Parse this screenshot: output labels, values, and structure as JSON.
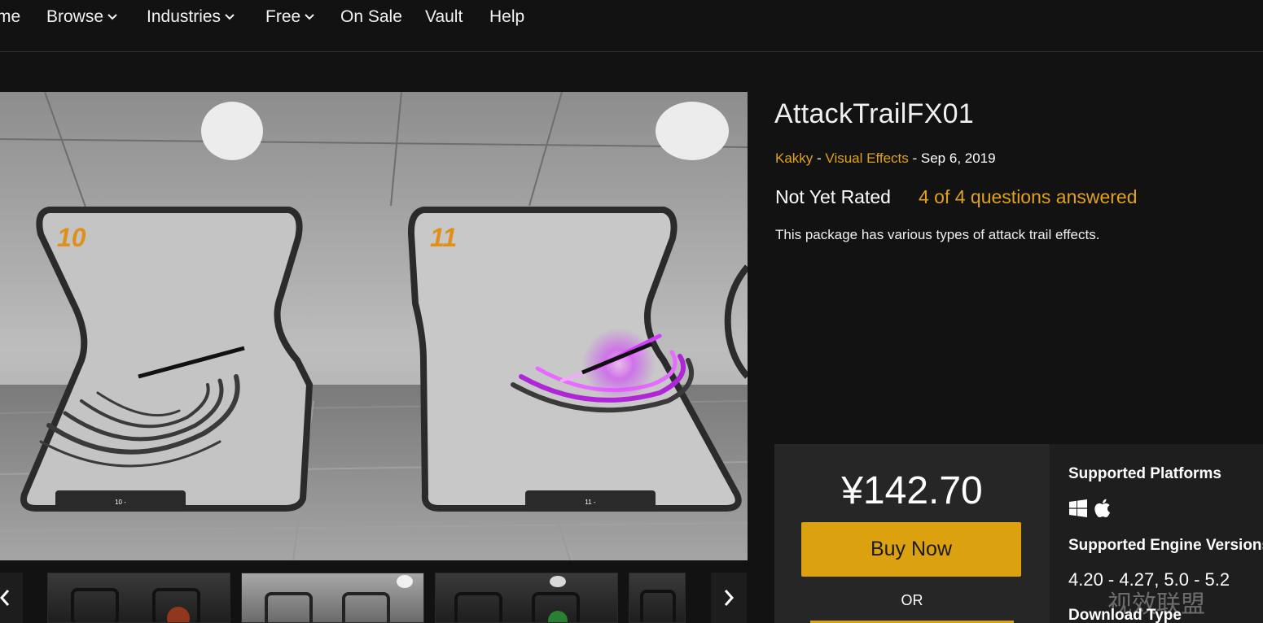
{
  "nav": {
    "items": [
      {
        "label": "me",
        "has_dropdown": false
      },
      {
        "label": "Browse",
        "has_dropdown": true
      },
      {
        "label": "Industries",
        "has_dropdown": true
      },
      {
        "label": "Free",
        "has_dropdown": true
      },
      {
        "label": "On Sale",
        "has_dropdown": false
      },
      {
        "label": "Vault",
        "has_dropdown": false
      },
      {
        "label": "Help",
        "has_dropdown": false
      }
    ]
  },
  "hero": {
    "panel_left_number": "10",
    "panel_right_number": "11",
    "panel_left_plate": "10 -",
    "panel_right_plate": "11 -"
  },
  "thumbnails": {
    "prev_icon": "chevron-left-icon",
    "next_icon": "chevron-right-icon",
    "next_glyph": "›"
  },
  "product": {
    "title": "AttackTrailFX01",
    "seller": "Kakky",
    "separator": " - ",
    "category": "Visual Effects",
    "date": "Sep 6, 2019",
    "rating": "Not Yet Rated",
    "questions": "4 of 4 questions answered",
    "description": "This package has various types of attack trail effects."
  },
  "purchase": {
    "price": "¥142.70",
    "buy_label": "Buy Now",
    "or_label": "OR",
    "accent_color": "#dca10e"
  },
  "specs": {
    "platforms_heading": "Supported Platforms",
    "platform_icons": [
      "windows-icon",
      "apple-icon"
    ],
    "engine_heading": "Supported Engine Versions",
    "engine_versions": "4.20 - 4.27, 5.0 - 5.2",
    "download_heading": "Download Type"
  },
  "watermark": {
    "text": "视效联盟"
  },
  "colors": {
    "background": "#121212",
    "link": "#e0a21a",
    "effect_glow": "#d23cff"
  }
}
